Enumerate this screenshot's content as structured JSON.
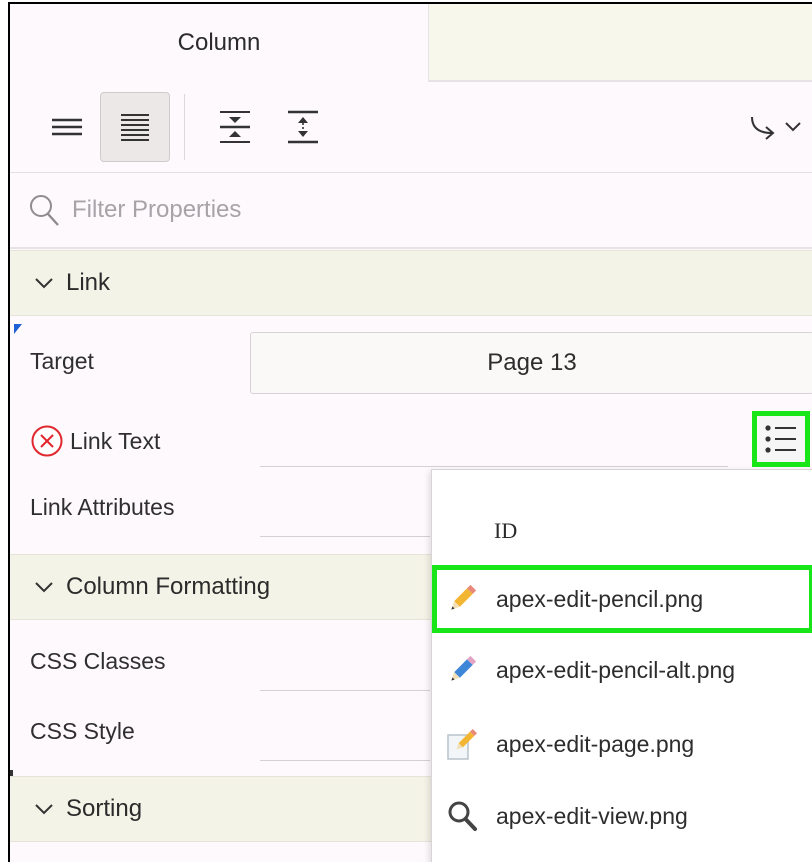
{
  "tabs": {
    "active": "Column",
    "inactive": ""
  },
  "toolbar": {
    "buttons": [
      "show-common-icon",
      "show-all-icon",
      "collapse-all-icon",
      "expand-all-icon",
      "go-to-group-icon"
    ]
  },
  "filter": {
    "placeholder": "Filter Properties"
  },
  "groups": {
    "link": "Link",
    "column_formatting": "Column Formatting",
    "sorting": "Sorting"
  },
  "properties": {
    "target": {
      "label": "Target",
      "value": "Page 13"
    },
    "link_text": {
      "label": "Link Text",
      "value": "",
      "error": true
    },
    "link_attributes": {
      "label": "Link Attributes",
      "value": ""
    },
    "css_classes": {
      "label": "CSS Classes",
      "value": ""
    },
    "css_style": {
      "label": "CSS Style",
      "value": ""
    }
  },
  "dropdown": {
    "header": "ID",
    "items": [
      {
        "label": "apex-edit-pencil.png",
        "icon": "pencil-icon",
        "selected": true
      },
      {
        "label": "apex-edit-pencil-alt.png",
        "icon": "pencil-alt-icon",
        "selected": false
      },
      {
        "label": "apex-edit-page.png",
        "icon": "page-icon",
        "selected": false
      },
      {
        "label": "apex-edit-view.png",
        "icon": "magnifier-icon",
        "selected": false
      }
    ]
  },
  "colors": {
    "highlight": "#19e619",
    "error": "#e0282e",
    "group_bg": "#f4f3e7"
  }
}
